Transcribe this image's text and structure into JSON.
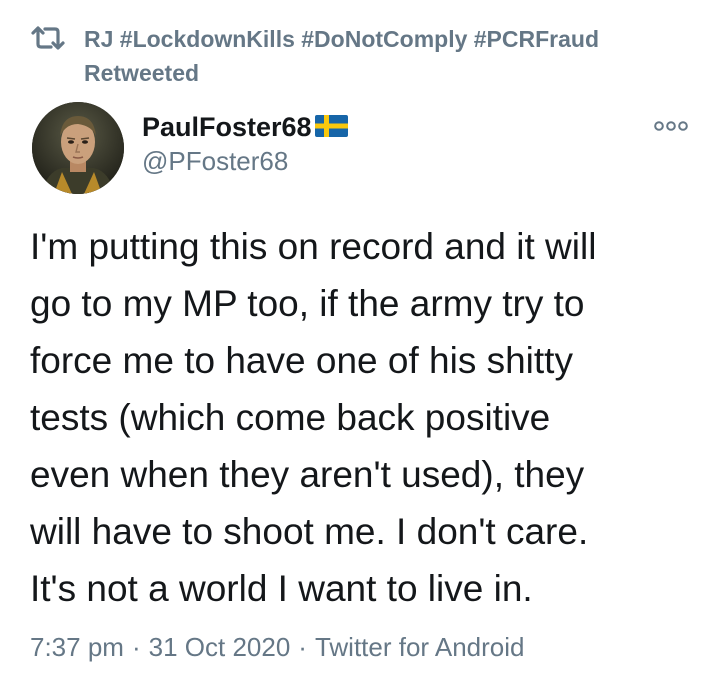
{
  "retweet_banner": {
    "icon": "retweet-icon",
    "line1": "RJ #LockdownKills #DoNotComply #PCRFraud",
    "line2": "Retweeted"
  },
  "author": {
    "display_name": "PaulFoster68",
    "flag_icon": "sweden-flag-icon",
    "handle": "@PFoster68"
  },
  "more_icon": "more-options-icon",
  "tweet": {
    "lines": [
      "I'm putting this on record and it will",
      "go to my MP too, if the army try to",
      "force me to have one of his shitty",
      "tests (which come back positive",
      "even when they aren't used), they",
      "will have to shoot me. I don't care.",
      "It's not a world I want to live in."
    ]
  },
  "meta": {
    "time": "7:37 pm",
    "separator": "·",
    "date": "31 Oct 2020",
    "client": "Twitter for Android"
  },
  "colors": {
    "text": "#14171a",
    "secondary": "#657786",
    "flag_blue": "#1665a8",
    "flag_yellow": "#f9c80e"
  }
}
